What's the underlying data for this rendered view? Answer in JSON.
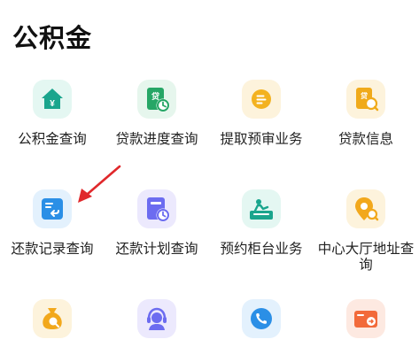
{
  "section_title": "公积金",
  "grid": [
    {
      "label": "公积金查询",
      "icon": "house-yuan-icon",
      "bg": "#e4f7f2",
      "fg": "#1aa58d"
    },
    {
      "label": "贷款进度查询",
      "icon": "loan-progress-clock-icon",
      "bg": "#e6f6ed",
      "fg": "#26a666"
    },
    {
      "label": "提取预审业务",
      "icon": "document-circle-icon",
      "bg": "#fdf3dc",
      "fg": "#f3b220"
    },
    {
      "label": "贷款信息",
      "icon": "loan-info-search-icon",
      "bg": "#fdf3dc",
      "fg": "#f0aa1a"
    },
    {
      "label": "还款记录查询",
      "icon": "repayment-record-icon",
      "bg": "#e3f1fd",
      "fg": "#2b8fe6"
    },
    {
      "label": "还款计划查询",
      "icon": "repayment-plan-icon",
      "bg": "#ece9fd",
      "fg": "#6c6cf0"
    },
    {
      "label": "预约柜台业务",
      "icon": "counter-appointment-icon",
      "bg": "#e4f7f2",
      "fg": "#1aa58d"
    },
    {
      "label": "中心大厅地址查询",
      "icon": "location-search-icon",
      "bg": "#fdf3dc",
      "fg": "#f2a81c"
    },
    {
      "label": "",
      "icon": "money-bag-search-icon",
      "bg": "#fdf3dc",
      "fg": "#f2a81c"
    },
    {
      "label": "",
      "icon": "customer-service-icon",
      "bg": "#ece9fd",
      "fg": "#6c6cf0"
    },
    {
      "label": "",
      "icon": "phone-icon",
      "bg": "#e3f1fd",
      "fg": "#2b8fe6"
    },
    {
      "label": "",
      "icon": "card-arrow-icon",
      "bg": "#fde9e1",
      "fg": "#f26a3a"
    }
  ],
  "annotation_color": "#e0282b"
}
